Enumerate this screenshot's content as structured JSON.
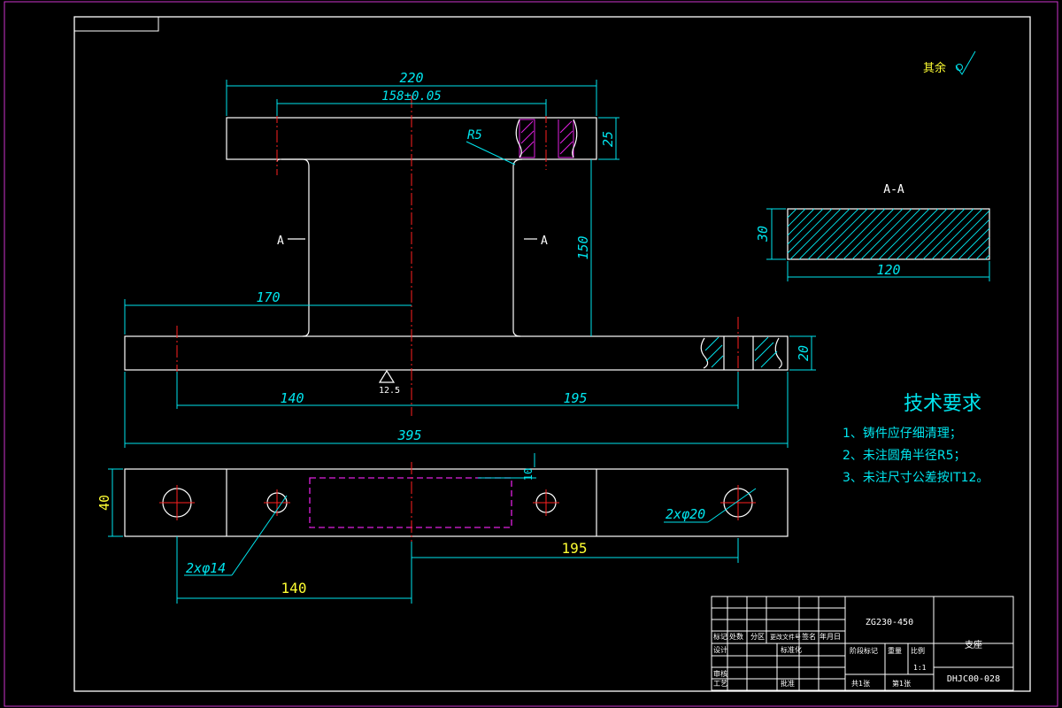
{
  "surface_mark": "其余",
  "section_label": "A-A",
  "section_marker_left": "A",
  "section_marker_right": "A",
  "dims": {
    "top_overall": "220",
    "top_holes": "158±0.05",
    "fillet": "R5",
    "top_thickness": "25",
    "web_height": "150",
    "base_left_to_center": "170",
    "base_thickness": "20",
    "base_hole_left": "140",
    "base_hole_right": "195",
    "base_overall": "395",
    "roughness": "12.5",
    "section_height": "30",
    "section_width": "120",
    "plan_width": "40",
    "plan_slot": "10",
    "plan_holes_small": "2xφ14",
    "plan_holes_large": "2xφ20",
    "plan_right": "195",
    "plan_left": "140"
  },
  "tech_req": {
    "title": "技术要求",
    "items": [
      "1、铸件应仔细清理；",
      "2、未注圆角半径R5；",
      "3、未注尺寸公差按IT12。"
    ]
  },
  "title_block": {
    "material": "ZG230-450",
    "part_name": "支座",
    "drawing_no": "DHJC00-028",
    "header_labels": [
      "标记",
      "处数",
      "分区",
      "更改文件号",
      "签名",
      "年月日"
    ],
    "row_design": "设计",
    "row_standard": "标准化",
    "row_review": "审核",
    "row_process": "工艺",
    "row_approve": "批准",
    "stage_mark": "阶段标记",
    "weight": "重量",
    "scale_label": "比例",
    "scale": "1:1",
    "sheets_total": "共1张",
    "sheet_no": "第1张"
  }
}
